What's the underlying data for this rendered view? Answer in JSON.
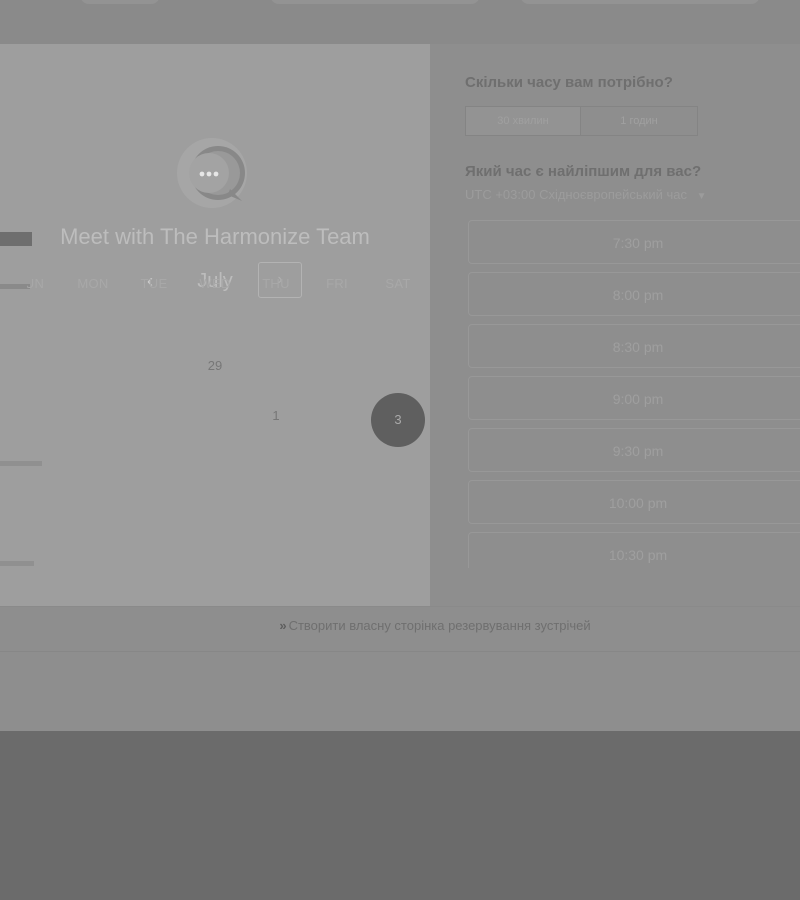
{
  "host": {
    "title": "Meet with The Harmonize Team"
  },
  "calendar": {
    "month": "July",
    "prev_symbol": "‹",
    "next_symbol": "›",
    "weekdays": [
      "SUN",
      "MON",
      "TUE",
      "WED",
      "THU",
      "FRI",
      "SAT"
    ],
    "visible_days": [
      {
        "label": "29",
        "state": "available"
      },
      {
        "label": "1",
        "state": "available"
      },
      {
        "label": "3",
        "state": "selected"
      }
    ]
  },
  "scheduler": {
    "duration_question": "Скільки часу вам потрібно?",
    "durations": [
      "30 хвилин",
      "1 годин"
    ],
    "time_question": "Який час є найліпшим для вас?",
    "timezone": "UTC +03:00 Східноєвропейський час",
    "timezone_icon": "caret-down-icon",
    "slots": [
      "7:30 pm",
      "8:00 pm",
      "8:30 pm",
      "9:00 pm",
      "9:30 pm",
      "10:00 pm",
      "10:30 pm"
    ]
  },
  "footer": {
    "icon": "bolt-icon",
    "link_text": "Створити власну сторінка резервування зустрічей"
  },
  "colors": {
    "overlay": "#6b6b6b",
    "selected_day": "#5f5f5f"
  }
}
